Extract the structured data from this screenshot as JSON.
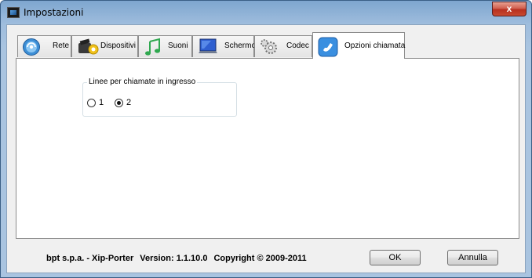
{
  "window": {
    "title": "Impostazioni",
    "close_symbol": "x"
  },
  "tabs": [
    {
      "label": "Rete",
      "icon": "network-globe-icon"
    },
    {
      "label": "Dispositivi",
      "icon": "camera-devices-icon"
    },
    {
      "label": "Suoni",
      "icon": "music-note-icon"
    },
    {
      "label": "Schermo",
      "icon": "monitor-icon"
    },
    {
      "label": "Codec",
      "icon": "gears-codec-icon"
    },
    {
      "label": "Opzioni chiamata",
      "icon": "phone-call-icon",
      "selected": true
    }
  ],
  "group": {
    "legend": "Linee per chiamate in ingresso",
    "options": [
      {
        "label": "1",
        "checked": false
      },
      {
        "label": "2",
        "checked": true
      }
    ]
  },
  "footer": {
    "company": "bpt s.p.a. - Xip-Porter",
    "version": "Version: 1.1.10.0",
    "copyright": "Copyright © 2009-2011"
  },
  "buttons": {
    "ok": "OK",
    "cancel": "Annulla"
  },
  "colors": {
    "title_bar": "#a9c4e0",
    "close_button": "#c84a30",
    "client_bg": "#f0f0f0"
  }
}
